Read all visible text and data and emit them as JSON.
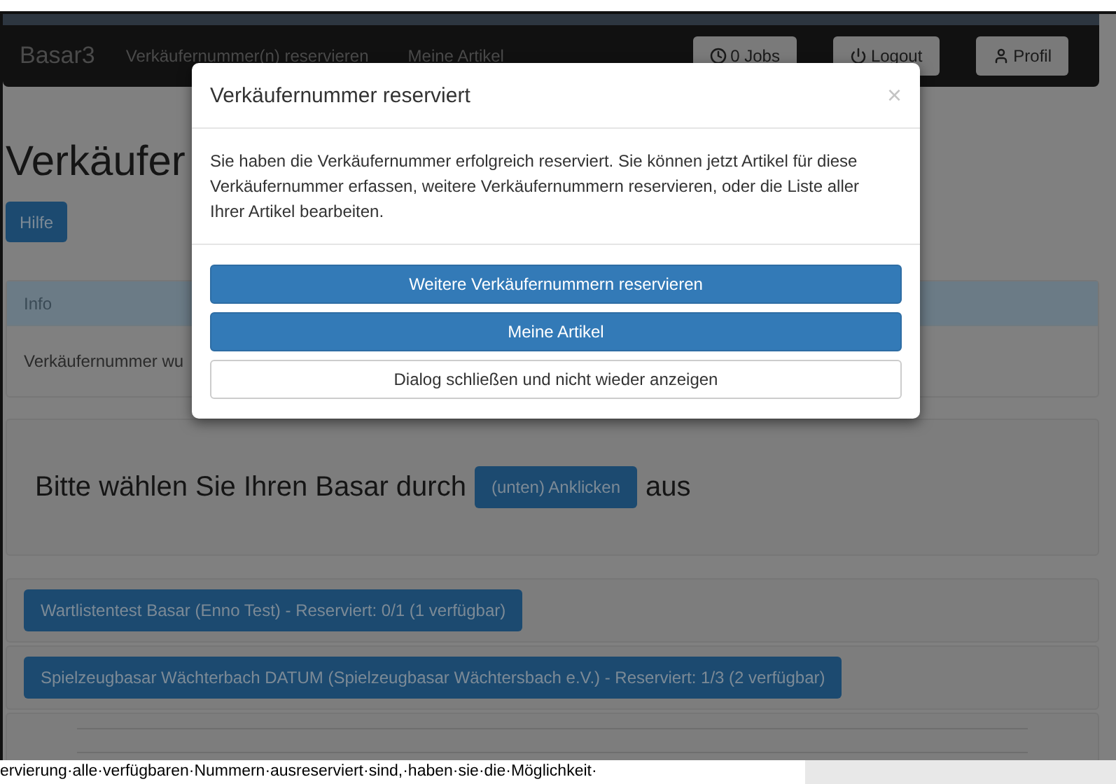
{
  "navbar": {
    "brand": "Basar3",
    "links": [
      "Verkäufernummer(n) reservieren",
      "Meine Artikel"
    ],
    "buttons": [
      {
        "kind": "clock",
        "label": "0 Jobs"
      },
      {
        "kind": "power",
        "label": "Logout"
      },
      {
        "kind": "user",
        "label": "Profil"
      }
    ]
  },
  "page": {
    "heading": "Verkäufer",
    "help_button": "Hilfe",
    "info_panel": {
      "title": "Info",
      "text": "Verkäufernummer wu"
    },
    "prompt": {
      "before": "Bitte wählen Sie Ihren Basar durch",
      "button": "(unten) Anklicken",
      "after": "aus"
    },
    "bazaars": [
      "Wartlistentest Basar (Enno Test) - Reserviert: 0/1 (1 verfügbar)",
      "Spielzeugbasar Wächterbach DATUM (Spielzeugbasar Wächtersbach e.V.) - Reserviert: 1/3 (2 verfügbar)"
    ]
  },
  "modal": {
    "title": "Verkäufernummer reserviert",
    "close": "×",
    "text": "Sie haben die Verkäufernummer erfolgreich reserviert. Sie können jetzt Artikel für diese Verkäufernummer erfassen, weitere Verkäufernummern reservieren, oder die Liste aller Ihrer Artikel bearbeiten.",
    "buttons": [
      {
        "kind": "primary",
        "label": "Weitere Verkäufernummern reservieren"
      },
      {
        "kind": "primary",
        "label": "Meine Artikel"
      },
      {
        "kind": "default",
        "label": "Dialog schließen und nicht wieder anzeigen"
      }
    ]
  },
  "document_text": "ervierung·alle·verfügbaren·Nummern·ausreserviert·sind,·haben·sie·die·Möglichkeit·"
}
